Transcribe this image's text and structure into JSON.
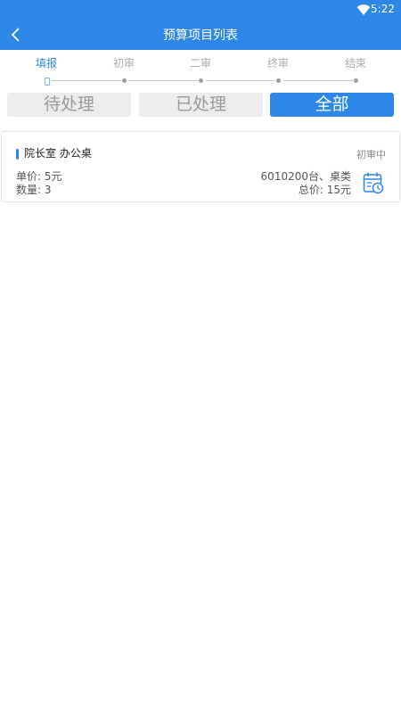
{
  "status_bar": {
    "time": "5:22",
    "wifi_icon": "wifi-icon"
  },
  "header": {
    "title": "预算项目列表",
    "back_icon": "chevron-left-icon"
  },
  "stages": [
    {
      "label": "填报",
      "active": true
    },
    {
      "label": "初审",
      "active": false
    },
    {
      "label": "二审",
      "active": false
    },
    {
      "label": "终审",
      "active": false
    },
    {
      "label": "结束",
      "active": false
    }
  ],
  "filter_tabs": [
    {
      "label": "待处理",
      "selected": false
    },
    {
      "label": "已处理",
      "selected": false
    },
    {
      "label": "全部",
      "selected": true
    }
  ],
  "items": [
    {
      "title": "院长室 办公桌",
      "status": "初审中",
      "unit_price": "单价: 5元",
      "quantity": "数量: 3",
      "code": "6010200台、桌类",
      "total": "总价: 15元",
      "icon": "calendar-clock-icon"
    }
  ],
  "colors": {
    "accent": "#2d87e6",
    "inactive_text": "#aaaaaa",
    "tab_bg": "#ececec"
  }
}
